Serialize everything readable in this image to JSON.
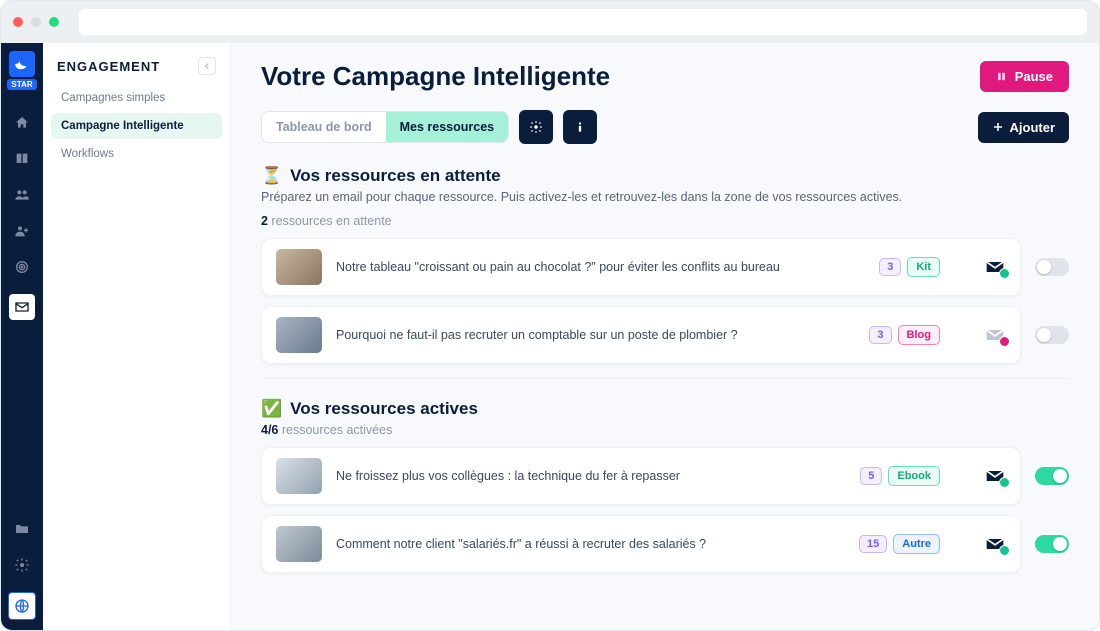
{
  "rail": {
    "star_label": "STAR"
  },
  "sidebar": {
    "title": "ENGAGEMENT",
    "items": [
      {
        "label": "Campagnes simples"
      },
      {
        "label": "Campagne Intelligente"
      },
      {
        "label": "Workflows"
      }
    ]
  },
  "header": {
    "title": "Votre Campagne Intelligente",
    "pause": "Pause"
  },
  "toolbar": {
    "tab_dashboard": "Tableau de bord",
    "tab_resources": "Mes ressources",
    "add": "Ajouter"
  },
  "pending": {
    "icon": "⏳",
    "title": "Vos ressources en attente",
    "subtitle": "Préparez un email pour chaque ressource. Puis activez-les et retrouvez-les dans la zone de vos ressources actives.",
    "count_num": "2",
    "count_label": " ressources en attente",
    "items": [
      {
        "title": "Notre tableau \"croissant ou pain au chocolat ?\" pour éviter les conflits au bureau",
        "num": "3",
        "tag": "Kit"
      },
      {
        "title": "Pourquoi ne faut-il pas recruter un comptable sur un poste de plombier ?",
        "num": "3",
        "tag": "Blog"
      }
    ]
  },
  "active": {
    "icon": "✅",
    "title": "Vos ressources actives",
    "count_num": "4/6",
    "count_label": " ressources activées",
    "items": [
      {
        "title": "Ne froissez plus vos collègues : la technique du fer à repasser",
        "num": "5",
        "tag": "Ebook"
      },
      {
        "title": "Comment notre client \"salariés.fr\" a réussi à recruter des salariés ?",
        "num": "15",
        "tag": "Autre"
      }
    ]
  }
}
